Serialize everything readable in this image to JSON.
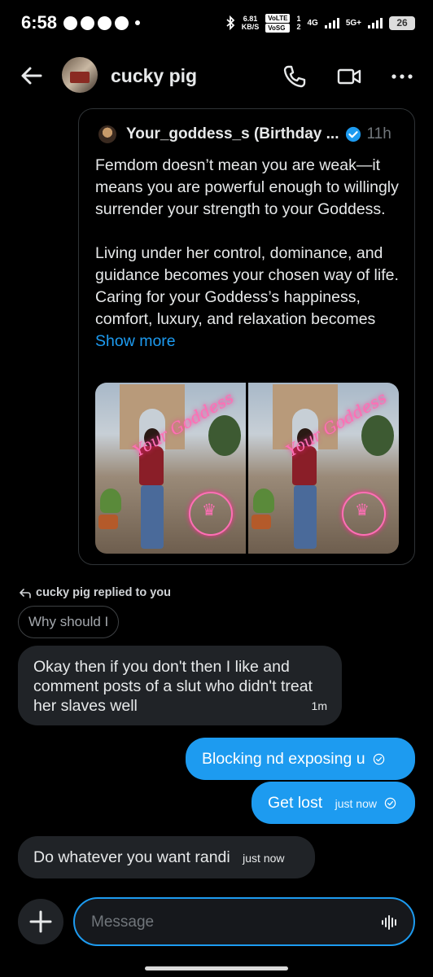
{
  "status_bar": {
    "time": "6:58",
    "speed_value": "6.81",
    "speed_unit": "KB/S",
    "sim1_label": "VoLTE",
    "sim2_label": "VoSG",
    "sim1_num": "1",
    "sim2_num": "2",
    "net1": "4G",
    "net2": "5G+",
    "battery": "26"
  },
  "header": {
    "contact_name": "cucky pig"
  },
  "quoted_post": {
    "author": "Your_goddess_s (Birthday ...",
    "time": "11h",
    "text": "Femdom doesn’t mean you are weak—it means you are powerful enough to willingly surrender your strength to your Goddess.\n\nLiving under her control, dominance, and guidance becomes your chosen way of life. Caring for your Goddess’s happiness, comfort, luxury, and relaxation becomes",
    "show_more": "Show more",
    "media_watermark_1": "Your Goddess",
    "media_watermark_2": "Your Goddess"
  },
  "reply_context": {
    "label": "cucky pig replied to you",
    "quoted_text": "Why should I"
  },
  "messages": [
    {
      "direction": "in",
      "text": "Okay then if you don't then I like and comment posts of a slut who didn't treat her slaves well",
      "time": "1m"
    },
    {
      "direction": "out",
      "text": "Blocking nd exposing  u",
      "time": ""
    },
    {
      "direction": "out",
      "text": "Get lost",
      "time": "just now"
    },
    {
      "direction": "in",
      "text": "Do whatever you want randi",
      "time": "just now"
    }
  ],
  "composer": {
    "placeholder": "Message"
  },
  "colors": {
    "accent": "#1d9bf0",
    "background": "#000000",
    "incoming_bubble": "#202327"
  }
}
